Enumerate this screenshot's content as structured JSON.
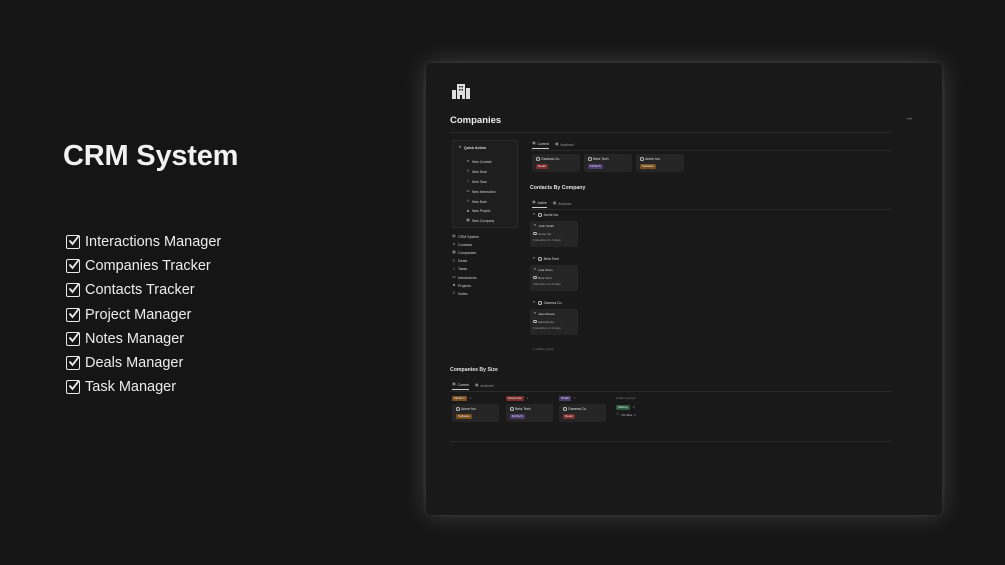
{
  "promo": {
    "title": "CRM System",
    "features": [
      "Interactions Manager",
      "Companies Tracker",
      "Contacts Tracker",
      "Project Manager",
      "Notes Manager",
      "Deals Manager",
      "Task Manager"
    ]
  },
  "window": {
    "page_icon": "building-icon",
    "title": "Companies",
    "collapse_label": "–",
    "quick_action": {
      "title": "Quick Action",
      "items": [
        "New Contact",
        "New Deal",
        "New Task",
        "New Interaction",
        "New Note",
        "New Project",
        "New Company"
      ]
    },
    "nav": {
      "items": [
        "CRM System",
        "Contacts",
        "Companies",
        "Deals",
        "Tasks",
        "Interactions",
        "Projects",
        "Notes"
      ]
    },
    "companies_view": {
      "tabs": [
        "Current",
        "Archived"
      ],
      "cards": [
        {
          "name": "Gamma Co.",
          "tag": "Retail"
        },
        {
          "name": "Beta Tech",
          "tag": "FinTech"
        },
        {
          "name": "Acme Inc.",
          "tag": "Software"
        }
      ]
    },
    "contacts_by_company": {
      "title": "Contacts By Company",
      "tabs": [
        "Active",
        "Archived"
      ],
      "groups": [
        {
          "company": "Acme Inc.",
          "contact": "John Smith",
          "contact_company": "Acme Inc.",
          "meta": "Interaction in 3 days"
        },
        {
          "company": "Beta Tech",
          "contact": "Lisa Chen",
          "contact_company": "Beta Tech",
          "meta": "Interaction in 8 days"
        },
        {
          "company": "Gamma Co.",
          "contact": "Alex Rivera",
          "contact_company": "Gamma Co.",
          "meta": "Interaction in 2 days"
        }
      ],
      "hidden_group": "1 hidden group"
    },
    "companies_by_size": {
      "title": "Companies By Size",
      "tabs": [
        "Current",
        "Archived"
      ],
      "columns": [
        {
          "label": "Medium",
          "count": "1",
          "card": {
            "name": "Acme Inc.",
            "tag": "Software"
          }
        },
        {
          "label": "Enterprise",
          "count": "1",
          "card": {
            "name": "Beta Tech",
            "tag": "FinTech"
          }
        },
        {
          "label": "Small",
          "count": "1",
          "card": {
            "name": "Gamma Co.",
            "tag": "Retail"
          }
        }
      ],
      "hidden_groups": {
        "label": "Hidden groups",
        "startup": "Startup",
        "startup_count": "0",
        "no_size": "No Size",
        "no_size_count": "0"
      }
    }
  }
}
